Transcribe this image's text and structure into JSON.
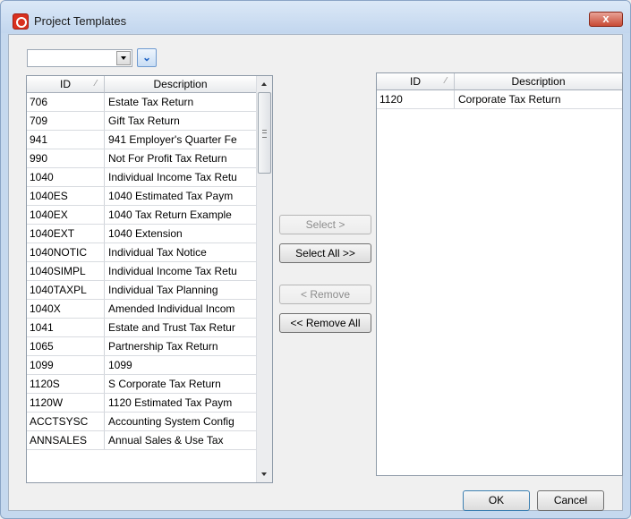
{
  "window": {
    "title": "Project Templates",
    "close_label": "x"
  },
  "toolbar": {
    "combo_value": "",
    "expand_icon": "double-chevron-down-icon"
  },
  "columns": {
    "id": "ID",
    "description": "Description",
    "sort_marker": "⁄"
  },
  "available": [
    {
      "id": "706",
      "description": "Estate Tax Return"
    },
    {
      "id": "709",
      "description": "Gift Tax Return"
    },
    {
      "id": "941",
      "description": "941 Employer's Quarter Fe"
    },
    {
      "id": "990",
      "description": "Not For Profit Tax Return"
    },
    {
      "id": "1040",
      "description": "Individual Income Tax Retu"
    },
    {
      "id": "1040ES",
      "description": "1040 Estimated Tax Paym"
    },
    {
      "id": "1040EX",
      "description": "1040 Tax Return Example"
    },
    {
      "id": "1040EXT",
      "description": "1040 Extension"
    },
    {
      "id": "1040NOTIC",
      "description": "Individual Tax Notice"
    },
    {
      "id": "1040SIMPL",
      "description": "Individual Income Tax Retu"
    },
    {
      "id": "1040TAXPL",
      "description": "Individual Tax Planning"
    },
    {
      "id": "1040X",
      "description": "Amended Individual Incom"
    },
    {
      "id": "1041",
      "description": "Estate and Trust Tax Retur"
    },
    {
      "id": "1065",
      "description": "Partnership Tax Return"
    },
    {
      "id": "1099",
      "description": "1099"
    },
    {
      "id": "1120S",
      "description": "S Corporate Tax Return"
    },
    {
      "id": "1120W",
      "description": "1120 Estimated Tax Paym"
    },
    {
      "id": "ACCTSYSC",
      "description": "Accounting System Config"
    },
    {
      "id": "ANNSALES",
      "description": "Annual Sales & Use Tax"
    }
  ],
  "selected": [
    {
      "id": "1120",
      "description": "Corporate Tax Return"
    }
  ],
  "buttons": {
    "select": "Select >",
    "select_all": "Select All >>",
    "remove": "< Remove",
    "remove_all": "<< Remove All",
    "ok": "OK",
    "cancel": "Cancel"
  },
  "colors": {
    "title_bar": "#c5d8ee",
    "close_button": "#c84a34",
    "app_icon": "#d9301f"
  }
}
